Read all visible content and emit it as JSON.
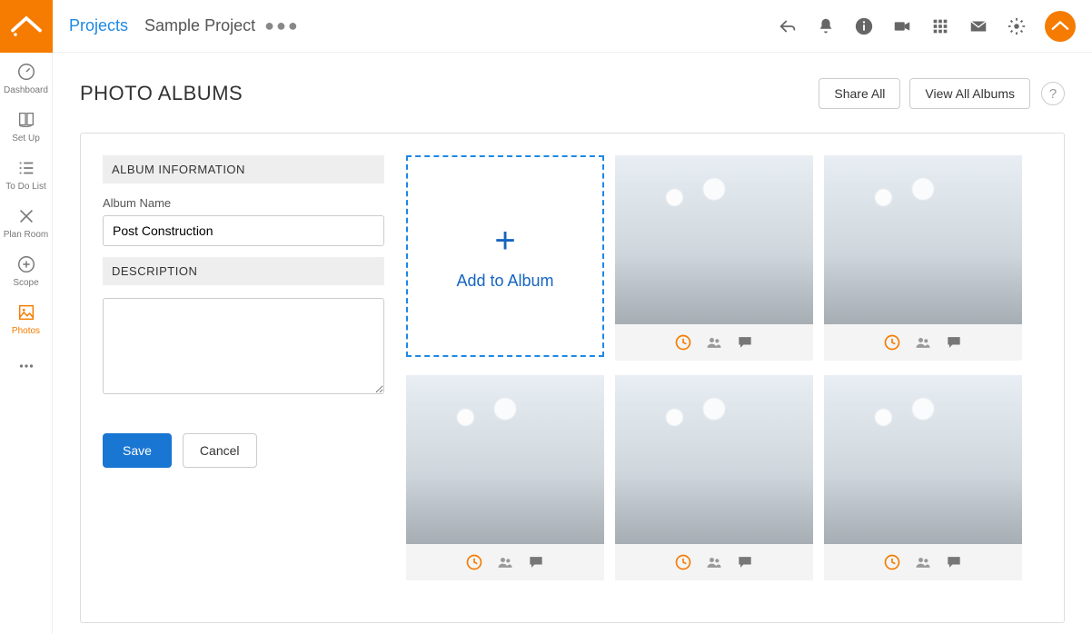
{
  "sidebar": {
    "items": [
      {
        "label": "Dashboard"
      },
      {
        "label": "Set Up"
      },
      {
        "label": "To Do List"
      },
      {
        "label": "Plan Room"
      },
      {
        "label": "Scope"
      },
      {
        "label": "Photos"
      }
    ]
  },
  "breadcrumb": {
    "root": "Projects",
    "current": "Sample Project"
  },
  "page": {
    "title": "PHOTO ALBUMS",
    "share_btn": "Share All",
    "view_all_btn": "View All Albums",
    "help": "?"
  },
  "form": {
    "section_info": "ALBUM INFORMATION",
    "album_name_label": "Album Name",
    "album_name_value": "Post Construction",
    "section_desc": "DESCRIPTION",
    "description_value": "",
    "save": "Save",
    "cancel": "Cancel"
  },
  "grid": {
    "add_label": "Add to Album"
  }
}
